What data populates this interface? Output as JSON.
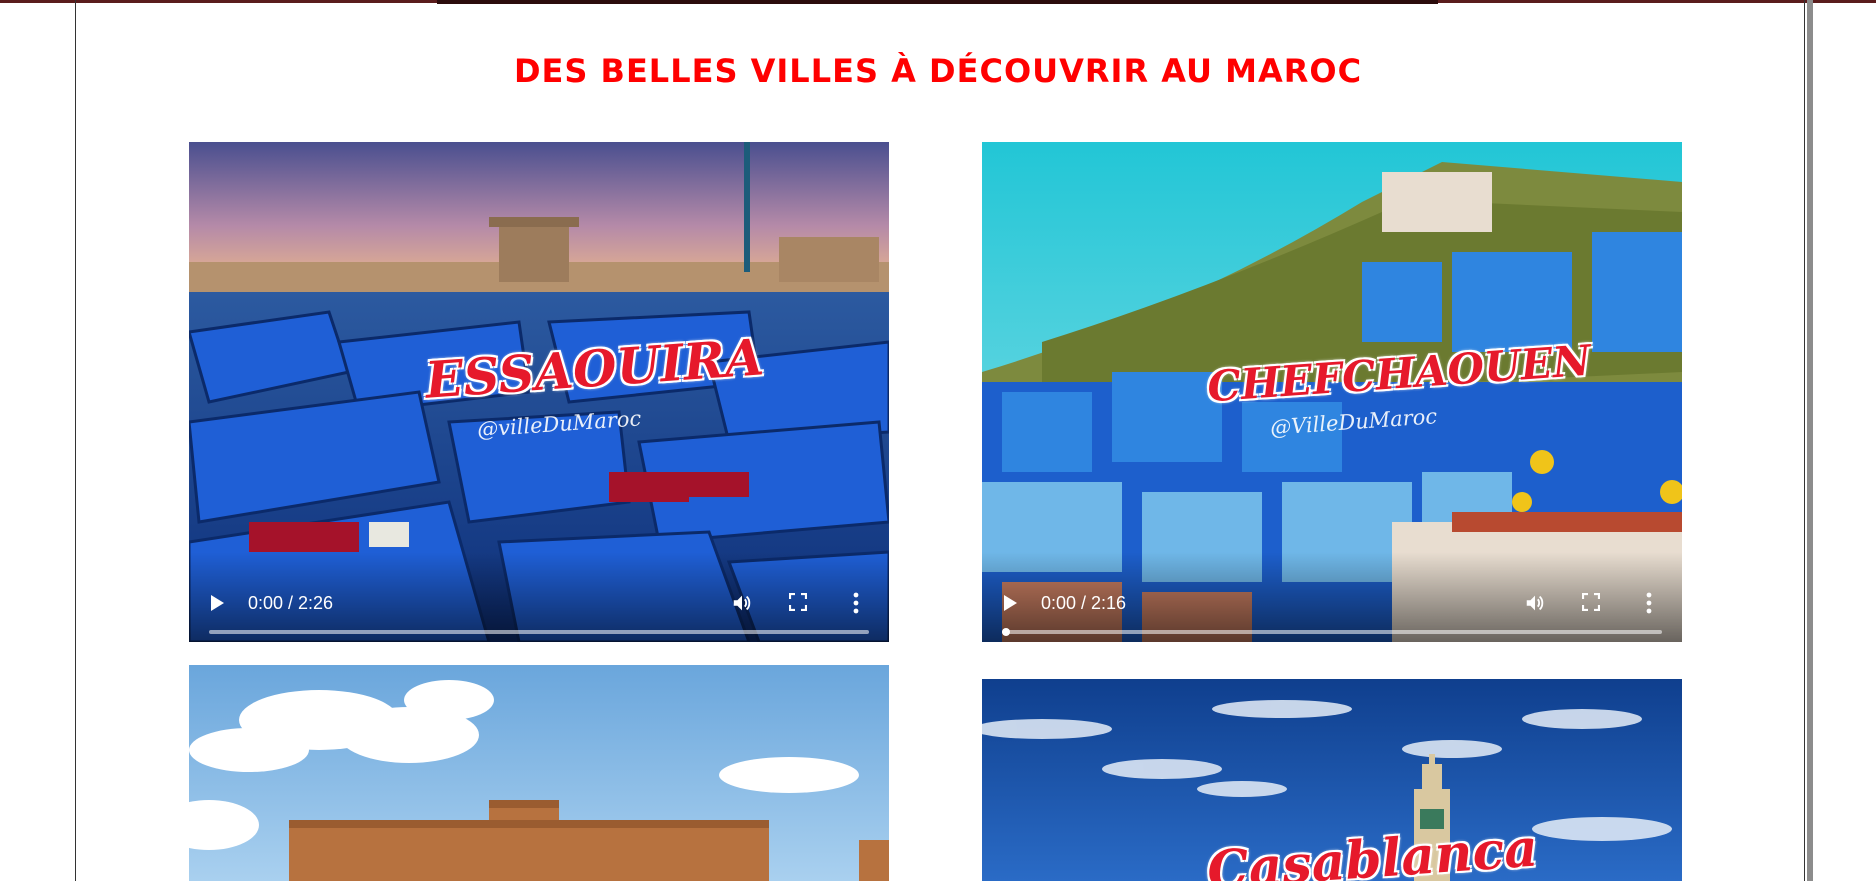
{
  "page": {
    "title": "DES BELLES VILLES À DÉCOUVRIR AU MAROC"
  },
  "videos": [
    {
      "label": "ESSAOUIRA",
      "watermark": "@villeDuMaroc",
      "time": "0:00 / 2:26",
      "progress": 0
    },
    {
      "label": "CHEFCHAOUEN",
      "watermark": "@VilleDuMaroc",
      "time": "0:00 / 2:16",
      "progress": 0
    },
    {
      "label": ""
    },
    {
      "label": "Casablanca"
    }
  ],
  "icons": {
    "play": "play-icon",
    "volume": "volume-icon",
    "fullscreen": "fullscreen-icon",
    "more": "more-options-icon"
  },
  "colors": {
    "title": "#ff0000",
    "label": "#e6192b",
    "frame_border": "#333333"
  }
}
